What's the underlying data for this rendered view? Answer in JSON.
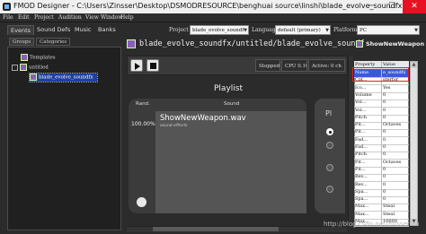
{
  "window": {
    "title": "FMOD Designer - C:\\Users\\Zinsser\\Desktop\\DSMODRESOURCE\\benghuai source\\linshi\\blade_evolve_soundfx.fdp *",
    "minimize": "─",
    "maximize": "☐",
    "close": "✕"
  },
  "menu": [
    "File",
    "Edit",
    "Project",
    "Audition",
    "View",
    "Window",
    "Help"
  ],
  "top_tabs": [
    "Events",
    "Sound Defs",
    "Music",
    "Banks"
  ],
  "sub_tabs": [
    "Groups",
    "Categories"
  ],
  "tree": {
    "nodes": [
      "Templates",
      "untitled",
      "blade_evolve_soundfx"
    ],
    "expand_box": "-"
  },
  "toolbar": {
    "project_label": "Project",
    "project_value": "blade_evolve_soundf",
    "language_label": "Language",
    "language_value": "default (primary)",
    "platform_label": "Platform",
    "platform_value": "PC"
  },
  "event_path": "blade_evolve_soundfx/untitled/blade_evolve_soundf",
  "transport": {
    "status": "Stopped",
    "cpu": "CPU 0.10",
    "active": "Active: 0 ch"
  },
  "playlist": {
    "title": "Playlist",
    "col_rand": "Rand.",
    "col_sound": "Sound",
    "rand_value": "100.00%",
    "sound_name": "ShowNewWeapon.wav",
    "sound_sub": "sound effects"
  },
  "playmode_label": "Pl",
  "properties": {
    "title": "ShowNewWeapon",
    "col_property": "Property",
    "col_value": "Value",
    "rows": [
      {
        "k": "Name",
        "v": "e_soundfx"
      },
      {
        "k": "Cat...",
        "v": "sterfor"
      },
      {
        "k": "Ico...",
        "v": "Yes"
      },
      {
        "k": "Volume",
        "v": "0"
      },
      {
        "k": "Vol...",
        "v": "0"
      },
      {
        "k": "Vol...",
        "v": "0"
      },
      {
        "k": "Pitch",
        "v": "0"
      },
      {
        "k": "Pit...",
        "v": "Octaves"
      },
      {
        "k": "Pit...",
        "v": "0"
      },
      {
        "k": "Fad...",
        "v": "0"
      },
      {
        "k": "Fad...",
        "v": "0"
      },
      {
        "k": "Pitch",
        "v": "0"
      },
      {
        "k": "Pit...",
        "v": "Octaves"
      },
      {
        "k": "Pit...",
        "v": "0"
      },
      {
        "k": "Rev...",
        "v": "0"
      },
      {
        "k": "Rev...",
        "v": "0"
      },
      {
        "k": "Spa...",
        "v": "0"
      },
      {
        "k": "Spa...",
        "v": "0"
      },
      {
        "k": "Max...",
        "v": "Steal"
      },
      {
        "k": "Max...",
        "v": "Steal"
      },
      {
        "k": "Max...",
        "v": "10000"
      }
    ]
  },
  "watermark": "http://blog.csdn.net/zinsserlan"
}
